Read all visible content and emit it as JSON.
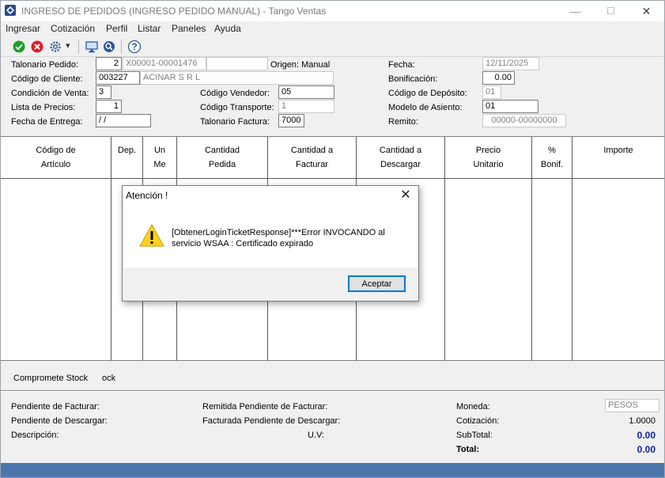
{
  "window": {
    "title": "INGRESO DE PEDIDOS (INGRESO PEDIDO MANUAL) - Tango Ventas",
    "minimize_glyph": "—",
    "maximize_glyph": "☐",
    "close_glyph": "✕"
  },
  "menu": [
    "Ingresar",
    "Cotización",
    "Perfil",
    "Listar",
    "Paneles",
    "Ayuda"
  ],
  "toolbar": {
    "dropdown_glyph": "▾",
    "help_glyph": "?"
  },
  "header": {
    "talonario_pedido_label": "Talonario Pedido:",
    "talonario_pedido_value": "2",
    "talonario_pedido_number": "X00001-00001476",
    "talonario_pedido_extra": "",
    "origen": "Origen: Manual",
    "fecha_label": "Fecha:",
    "fecha_value": "12/11/2025",
    "codigo_cliente_label": "Código de Cliente:",
    "codigo_cliente_value": "003227",
    "cliente_nombre": "ACINAR S R L",
    "bonificacion_label": "Bonificación:",
    "bonificacion_value": "0.00",
    "condicion_venta_label": "Condición de Venta:",
    "condicion_venta_value": "3",
    "codigo_vendedor_label": "Código Vendedor:",
    "codigo_vendedor_value": "05",
    "codigo_deposito_label": "Código de Depósito:",
    "codigo_deposito_value": "01",
    "lista_precios_label": "Lista de Precios:",
    "lista_precios_value": "1",
    "codigo_transporte_label": "Código Transporte:",
    "codigo_transporte_value": "1",
    "modelo_asiento_label": "Modelo de Asiento:",
    "modelo_asiento_value": "01",
    "fecha_entrega_label": "Fecha de Entrega:",
    "fecha_entrega_value": " / /",
    "talonario_factura_label": "Talonario Factura:",
    "talonario_factura_value": "7000",
    "remito_label": "Remito:",
    "remito_value": "00000-00000000"
  },
  "grid_columns": [
    {
      "line1": "Código de",
      "line2": "Artículo"
    },
    {
      "line1": "Dep.",
      "line2": ""
    },
    {
      "line1": "Un",
      "line2": "Me"
    },
    {
      "line1": "Cantidad",
      "line2": "Pedida"
    },
    {
      "line1": "Cantidad a",
      "line2": "Facturar"
    },
    {
      "line1": "Cantidad a",
      "line2": "Descargar"
    },
    {
      "line1": "Precio",
      "line2": "Unitario"
    },
    {
      "line1": "%",
      "line2": "Bonif."
    },
    {
      "line1": "Importe",
      "line2": ""
    }
  ],
  "stock": {
    "label": "Compromete Stock",
    "value": "ock"
  },
  "footer": {
    "pendiente_facturar": "Pendiente de Facturar:",
    "pendiente_descargar": "Pendiente de Descargar:",
    "descripcion": "Descripción:",
    "remitida_pendiente": "Remitida Pendiente de Facturar:",
    "facturada_pendiente": "Facturada Pendiente de Descargar:",
    "uv": "U.V:",
    "moneda_label": "Moneda:",
    "moneda_value": "PESOS",
    "cotizacion_label": "Cotización:",
    "cotizacion_value": "1.0000",
    "subtotal_label": "SubTotal:",
    "subtotal_value": "0.00",
    "total_label": "Total:",
    "total_value": "0.00"
  },
  "dialog": {
    "title": "Atención !",
    "close_glyph": "✕",
    "message_line1": "[ObtenerLoginTicketResponse]***Error INVOCANDO al",
    "message_line2": "servicio WSAA : Certificado expirado",
    "button": "Aceptar"
  }
}
